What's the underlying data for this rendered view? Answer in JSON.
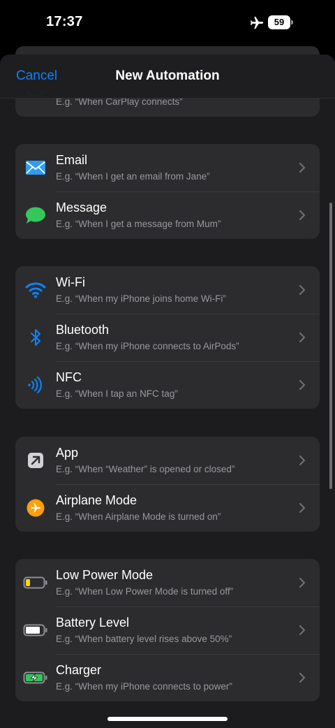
{
  "status_bar": {
    "time": "17:37",
    "battery": "59"
  },
  "nav": {
    "cancel_label": "Cancel",
    "title": "New Automation"
  },
  "partial_row": {
    "subtitle": "E.g. “When CarPlay connects”"
  },
  "groups": [
    {
      "items": [
        {
          "title": "Email",
          "subtitle": "E.g. “When I get an email from Jane”",
          "icon": "envelope-icon"
        },
        {
          "title": "Message",
          "subtitle": "E.g. “When I get a message from Mum”",
          "icon": "message-bubble-icon"
        }
      ]
    },
    {
      "items": [
        {
          "title": "Wi-Fi",
          "subtitle": "E.g. “When my iPhone joins home Wi-Fi”",
          "icon": "wifi-icon"
        },
        {
          "title": "Bluetooth",
          "subtitle": "E.g. “When my iPhone connects to AirPods”",
          "icon": "bluetooth-icon"
        },
        {
          "title": "NFC",
          "subtitle": "E.g. “When I tap an NFC tag”",
          "icon": "nfc-icon"
        }
      ]
    },
    {
      "items": [
        {
          "title": "App",
          "subtitle": "E.g. “When “Weather” is opened or closed”",
          "icon": "app-arrow-icon"
        },
        {
          "title": "Airplane Mode",
          "subtitle": "E.g. “When Airplane Mode is turned on”",
          "icon": "airplane-icon"
        }
      ]
    },
    {
      "items": [
        {
          "title": "Low Power Mode",
          "subtitle": "E.g. “When Low Power Mode is turned off”",
          "icon": "low-power-battery-icon"
        },
        {
          "title": "Battery Level",
          "subtitle": "E.g. “When battery level rises above 50%”",
          "icon": "battery-icon"
        },
        {
          "title": "Charger",
          "subtitle": "E.g. “When my iPhone connects to power”",
          "icon": "charging-battery-icon"
        }
      ]
    }
  ],
  "colors": {
    "accent": "#0a84ff",
    "background": "#000000",
    "sheet": "#1c1c1e",
    "cell": "#2c2c2e",
    "airplane_orange": "#ff9f0a",
    "message_green": "#34c759",
    "low_power_yellow": "#ffd60a"
  }
}
